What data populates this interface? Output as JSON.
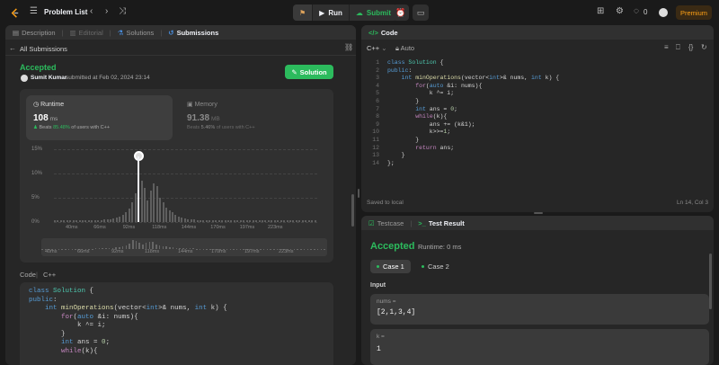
{
  "topbar": {
    "problem_list": "Problem List",
    "run": "Run",
    "submit": "Submit",
    "coins": "0",
    "premium": "Premium"
  },
  "left": {
    "tabs": [
      {
        "label": "Description"
      },
      {
        "label": "Editorial"
      },
      {
        "label": "Solutions"
      },
      {
        "label": "Submissions"
      }
    ],
    "back_label": "All Submissions",
    "status": "Accepted",
    "user": "Sumit Kumar",
    "submitted_text": "submitted at Feb 02, 2024 23:14",
    "solution_btn": "Solution",
    "runtime": {
      "label": "Runtime",
      "value": "108",
      "unit": "ms",
      "beats_prefix": "Beats",
      "beats_pct": "85.48%",
      "beats_suffix": "of users with C++"
    },
    "memory": {
      "label": "Memory",
      "value": "91.38",
      "unit": "MB",
      "beats_prefix": "Beats",
      "beats_pct": "5.46%",
      "beats_suffix": "of users with C++"
    },
    "code_label": "Code",
    "code_lang": "C++",
    "code_preview": [
      "class Solution {",
      "public:",
      "    int minOperations(vector<int>& nums, int k) {",
      "        for(auto &i: nums){",
      "            k ^= i;",
      "        }",
      "        int ans = 0;",
      "        while(k){"
    ]
  },
  "chart_data": {
    "type": "bar",
    "title": "",
    "ylabel": "",
    "yticks": [
      "15%",
      "10%",
      "5%",
      "0%"
    ],
    "ylim": [
      0,
      15
    ],
    "xticks": [
      "40ms",
      "66ms",
      "92ms",
      "118ms",
      "144ms",
      "170ms",
      "197ms",
      "223ms"
    ],
    "mini_xticks": [
      "40ms",
      "66ms",
      "92ms",
      "118ms",
      "144ms",
      "170ms",
      "197ms",
      "223ms"
    ],
    "highlight_value": 108,
    "values": [
      0.3,
      0.3,
      0.3,
      0.3,
      0.3,
      0.3,
      0.3,
      0.3,
      0.3,
      0.3,
      0.3,
      0.3,
      0.3,
      0.4,
      0.4,
      0.4,
      0.5,
      0.5,
      0.6,
      0.8,
      1.0,
      1.2,
      1.5,
      2.0,
      2.8,
      4.0,
      6.0,
      9.5,
      8.5,
      7.0,
      4.5,
      6.5,
      8.0,
      7.5,
      5.0,
      4.0,
      3.0,
      2.5,
      2.0,
      1.5,
      1.2,
      1.0,
      0.8,
      0.6,
      0.5,
      0.5,
      0.4,
      0.4,
      0.4,
      0.3,
      0.3,
      0.3,
      0.3,
      0.3,
      0.3,
      0.3,
      0.3,
      0.3,
      0.3,
      0.3,
      0.3,
      0.3,
      0.3,
      0.3,
      0.3,
      0.3,
      0.3,
      0.3,
      0.3,
      0.3,
      0.3,
      0.3,
      0.3,
      0.3,
      0.3,
      0.3,
      0.3,
      0.3,
      0.3,
      0.3,
      0.3,
      0.3,
      0.3,
      0.3,
      0.3
    ],
    "highlight_index": 27
  },
  "editor": {
    "tab": "Code",
    "lang": "C++",
    "mode": "Auto",
    "lines": [
      "class Solution {",
      "public:",
      "    int minOperations(vector<int>& nums, int k) {",
      "        for(auto &i: nums){",
      "            k ^= i;",
      "        }",
      "        int ans = 0;",
      "        while(k){",
      "            ans += (k&1);",
      "            k>>=1;",
      "        }",
      "        return ans;",
      "    }",
      "};"
    ],
    "line_numbers": [
      "1",
      "2",
      "3",
      "4",
      "5",
      "6",
      "7",
      "8",
      "9",
      "10",
      "11",
      "12",
      "13",
      "14"
    ],
    "saved": "Saved to local",
    "cursor": "Ln 14, Col 3"
  },
  "testpanel": {
    "tab_testcase": "Testcase",
    "tab_result": "Test Result",
    "status": "Accepted",
    "runtime": "Runtime: 0 ms",
    "case1": "Case 1",
    "case2": "Case 2",
    "input_label": "Input",
    "nums_label": "nums =",
    "nums_value": "[2,1,3,4]",
    "k_label": "k =",
    "k_value": "1"
  }
}
